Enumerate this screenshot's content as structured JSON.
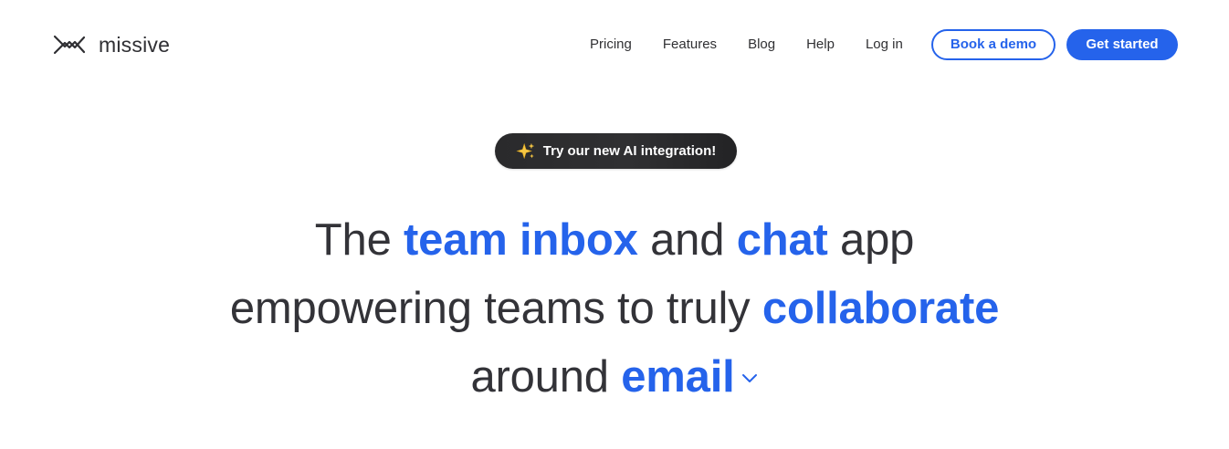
{
  "brand": {
    "name": "missive",
    "logo_icon": "missive-logo-icon"
  },
  "nav": {
    "items": [
      {
        "label": "Pricing"
      },
      {
        "label": "Features"
      },
      {
        "label": "Blog"
      },
      {
        "label": "Help"
      },
      {
        "label": "Log in"
      }
    ],
    "book_demo_label": "Book a demo",
    "get_started_label": "Get started"
  },
  "announcement": {
    "icon": "sparkles-icon",
    "label": "Try our new AI integration!"
  },
  "hero": {
    "line1": {
      "part1": "The ",
      "accent1": "team inbox",
      "part2": " and ",
      "accent2": "chat",
      "part3": " app"
    },
    "line2": {
      "part1": "empowering teams to truly ",
      "accent1": "collaborate"
    },
    "line3": {
      "part1": "around ",
      "accent1": "email",
      "dropdown_icon": "chevron-down-icon"
    }
  },
  "colors": {
    "accent": "#2563eb",
    "text": "#333338",
    "pill_background": "#2a2a2c",
    "background": "#ffffff"
  }
}
